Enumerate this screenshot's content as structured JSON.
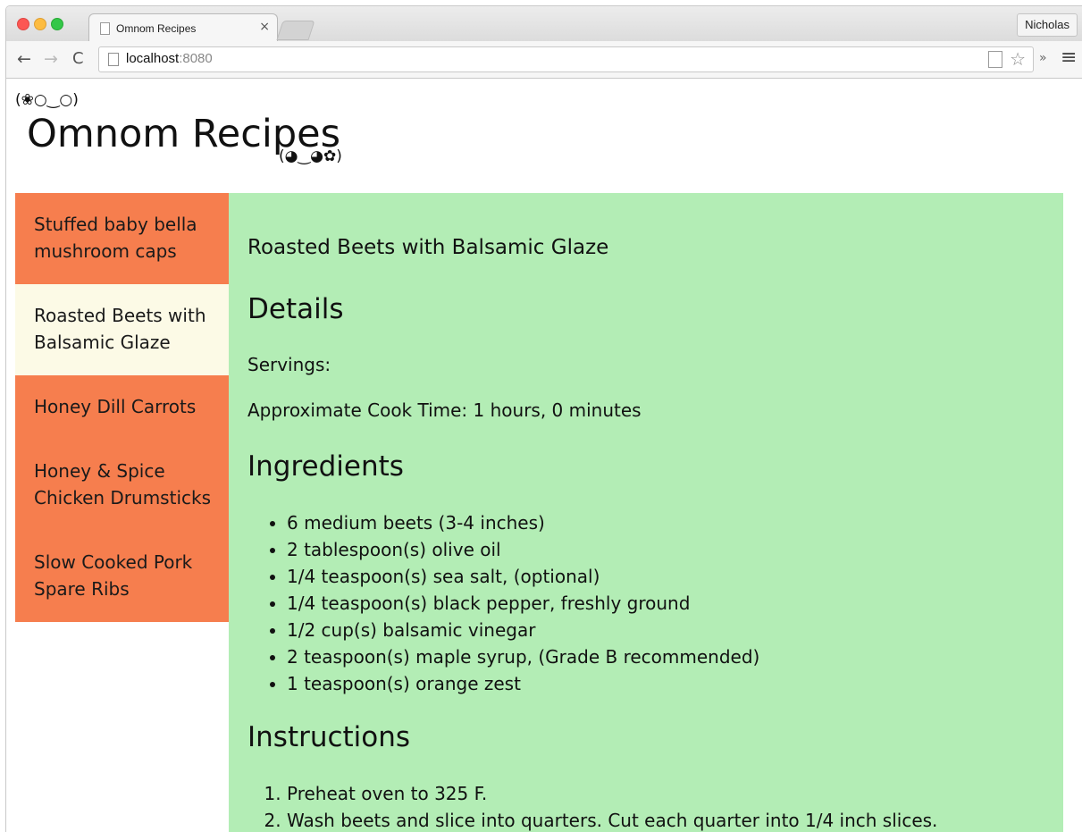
{
  "browser": {
    "tab_title": "Omnom Recipes",
    "tab_close": "×",
    "profile_name": "Nicholas",
    "url_host": "localhost",
    "url_port": ":8080",
    "nav_back": "←",
    "nav_forward": "→",
    "nav_reload": "C",
    "extensions": "»",
    "menu": "≡",
    "star": "☆"
  },
  "header": {
    "kaomoji_top": "(❀○‿○)",
    "title": "Omnom Recipes",
    "kaomoji_bottom": "(◕‿◕✿)"
  },
  "sidebar": {
    "items": [
      {
        "label": "Stuffed baby bella mushroom caps",
        "active": false
      },
      {
        "label": "Roasted Beets with Balsamic Glaze",
        "active": true
      },
      {
        "label": "Honey Dill Carrots",
        "active": false
      },
      {
        "label": "Honey & Spice Chicken Drumsticks",
        "active": false
      },
      {
        "label": "Slow Cooked Pork Spare Ribs",
        "active": false
      }
    ],
    "colors": {
      "item_bg": "#f67e4e",
      "active_bg": "#fcfae6"
    }
  },
  "recipe": {
    "name": "Roasted Beets with Balsamic Glaze",
    "details_heading": "Details",
    "servings": "Servings:",
    "cook_time": "Approximate Cook Time: 1 hours, 0 minutes",
    "ingredients_heading": "Ingredients",
    "ingredients": [
      "6 medium beets (3-4 inches)",
      "2 tablespoon(s) olive oil",
      "1/4 teaspoon(s) sea salt, (optional)",
      "1/4 teaspoon(s) black pepper, freshly ground",
      "1/2 cup(s) balsamic vinegar",
      "2 teaspoon(s) maple syrup, (Grade B recommended)",
      "1 teaspoon(s) orange zest"
    ],
    "instructions_heading": "Instructions",
    "instructions": [
      "Preheat oven to 325 F.",
      "Wash beets and slice into quarters. Cut each quarter into 1/4 inch slices."
    ],
    "content_bg": "#b3edb5"
  }
}
